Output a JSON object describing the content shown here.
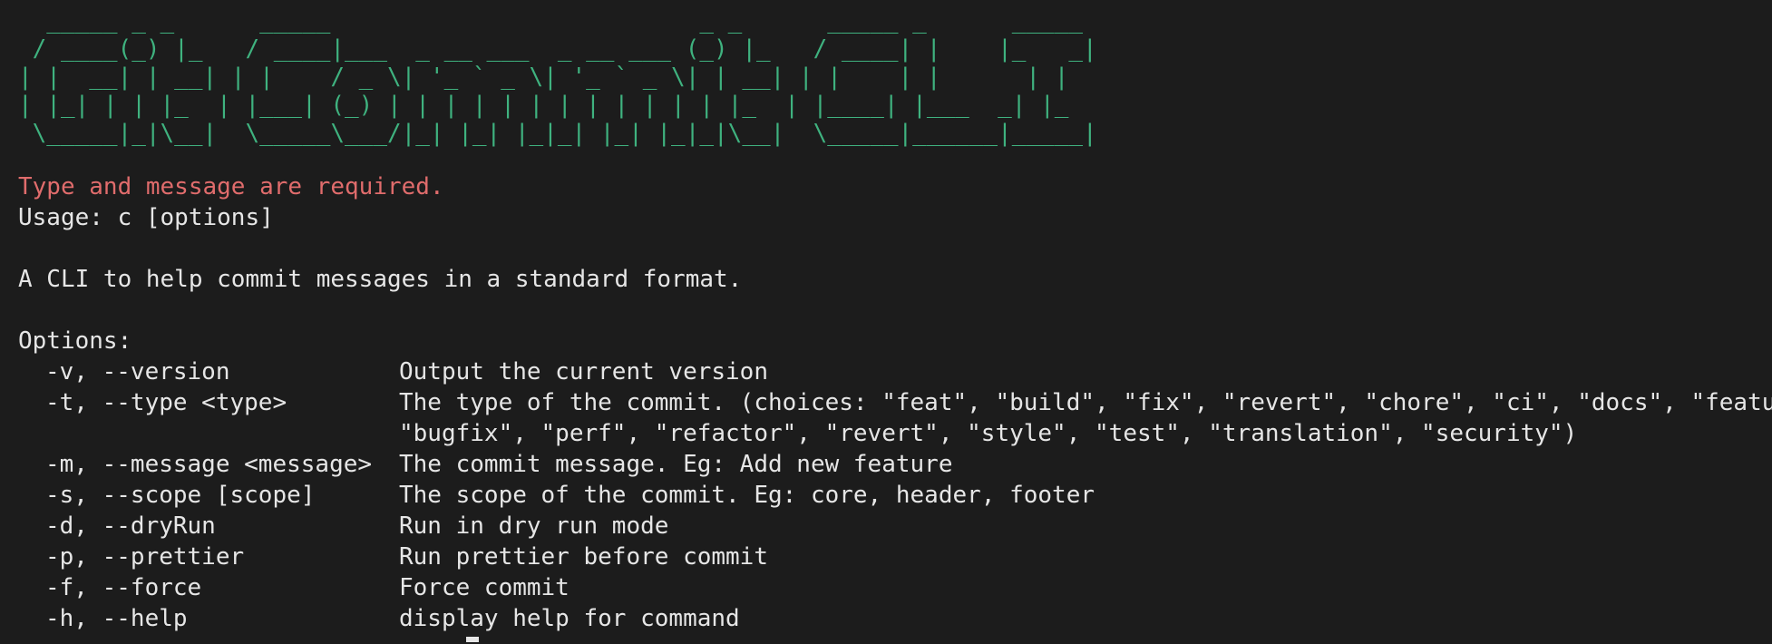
{
  "banner": {
    "lines": [
      "  _____ _ _      _____                          _ _      _____ _      _____ ",
      " / ____(_) |_   / ____|___  _ __ ___  _ __ ___ (_) |_   / ____| |    |_   _|",
      "| |  __| | __| | |    / _ \\| '_ ` _ \\| '_ ` _ \\| | __| | |    | |      | |  ",
      "| |_| | | |_  | |___| (_) | | | | | | | | | | | | |_  | |____| |___  _| |_ ",
      " \\_____|_|\\__|  \\_____\\___/|_| |_| |_|_| |_| |_|_|\\__|  \\_____|______|_____|"
    ]
  },
  "error": "Type and message are required.",
  "usage": "Usage: c [options]",
  "description": "A CLI to help commit messages in a standard format.",
  "options_header": "Options:",
  "options": [
    {
      "flag": "-v, --version",
      "desc": "Output the current version"
    },
    {
      "flag": "-t, --type <type>",
      "desc": "The type of the commit. (choices: \"feat\", \"build\", \"fix\", \"revert\", \"chore\", \"ci\", \"docs\", \"feature\","
    },
    {
      "flag": "",
      "desc": "\"bugfix\", \"perf\", \"refactor\", \"revert\", \"style\", \"test\", \"translation\", \"security\")"
    },
    {
      "flag": "-m, --message <message>",
      "desc": "The commit message. Eg: Add new feature"
    },
    {
      "flag": "-s, --scope [scope]",
      "desc": "The scope of the commit. Eg: core, header, footer"
    },
    {
      "flag": "-d, --dryRun",
      "desc": "Run in dry run mode"
    },
    {
      "flag": "-p, --prettier",
      "desc": "Run prettier before commit"
    },
    {
      "flag": "-f, --force",
      "desc": "Force commit"
    },
    {
      "flag": "-h, --help",
      "desc": "display help for command"
    }
  ],
  "colors": {
    "background": "#1c1c1c",
    "text": "#e6e6e6",
    "banner": "#3fb27f",
    "error": "#e06c6c"
  }
}
